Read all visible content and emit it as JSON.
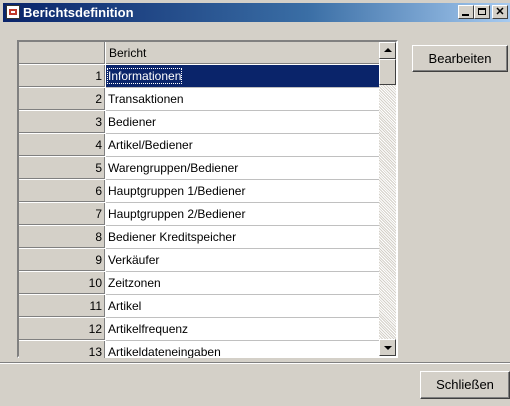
{
  "window": {
    "title": "Berichtsdefinition"
  },
  "grid": {
    "column_header": "Bericht",
    "selected_row": 1,
    "rows": [
      {
        "num": "1",
        "label": "Informationen"
      },
      {
        "num": "2",
        "label": "Transaktionen"
      },
      {
        "num": "3",
        "label": "Bediener"
      },
      {
        "num": "4",
        "label": "Artikel/Bediener"
      },
      {
        "num": "5",
        "label": "Warengruppen/Bediener"
      },
      {
        "num": "6",
        "label": "Hauptgruppen 1/Bediener"
      },
      {
        "num": "7",
        "label": "Hauptgruppen 2/Bediener"
      },
      {
        "num": "8",
        "label": "Bediener Kreditspeicher"
      },
      {
        "num": "9",
        "label": "Verkäufer"
      },
      {
        "num": "10",
        "label": "Zeitzonen"
      },
      {
        "num": "11",
        "label": "Artikel"
      },
      {
        "num": "12",
        "label": "Artikelfrequenz"
      },
      {
        "num": "13",
        "label": "Artikeldateneingaben"
      }
    ]
  },
  "buttons": {
    "edit": "Bearbeiten",
    "close": "Schließen"
  }
}
